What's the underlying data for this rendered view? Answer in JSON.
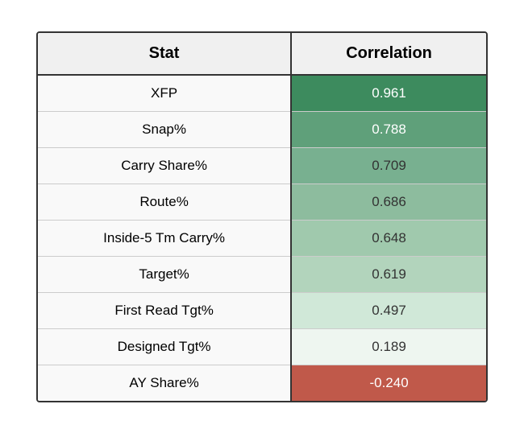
{
  "table": {
    "headers": {
      "stat": "Stat",
      "correlation": "Correlation"
    },
    "rows": [
      {
        "stat": "XFP",
        "correlation": "0.961",
        "colorClass": "color-1"
      },
      {
        "stat": "Snap%",
        "correlation": "0.788",
        "colorClass": "color-2"
      },
      {
        "stat": "Carry Share%",
        "correlation": "0.709",
        "colorClass": "color-3"
      },
      {
        "stat": "Route%",
        "correlation": "0.686",
        "colorClass": "color-4"
      },
      {
        "stat": "Inside-5 Tm Carry%",
        "correlation": "0.648",
        "colorClass": "color-5"
      },
      {
        "stat": "Target%",
        "correlation": "0.619",
        "colorClass": "color-6"
      },
      {
        "stat": "First Read Tgt%",
        "correlation": "0.497",
        "colorClass": "color-7"
      },
      {
        "stat": "Designed Tgt%",
        "correlation": "0.189",
        "colorClass": "color-8"
      },
      {
        "stat": "AY Share%",
        "correlation": "-0.240",
        "colorClass": "color-neg"
      }
    ]
  }
}
